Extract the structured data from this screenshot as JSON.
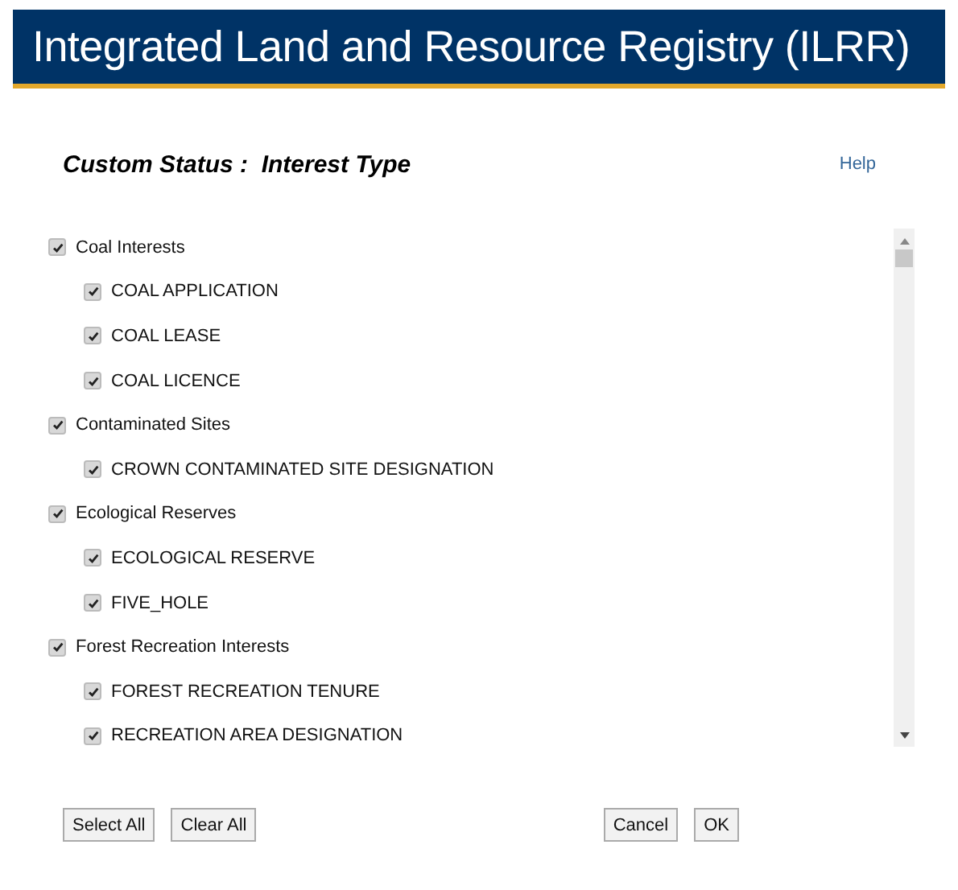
{
  "header": {
    "title": "Integrated Land and Resource Registry (ILRR)"
  },
  "page": {
    "heading": "Custom Status :  Interest Type",
    "help_link": "Help"
  },
  "tree": [
    {
      "label": "Coal Interests",
      "checked": true,
      "children": [
        {
          "label": "COAL APPLICATION",
          "checked": true
        },
        {
          "label": "COAL LEASE",
          "checked": true
        },
        {
          "label": "COAL LICENCE",
          "checked": true
        }
      ]
    },
    {
      "label": "Contaminated Sites",
      "checked": true,
      "children": [
        {
          "label": "CROWN CONTAMINATED SITE DESIGNATION",
          "checked": true
        }
      ]
    },
    {
      "label": "Ecological Reserves",
      "checked": true,
      "children": [
        {
          "label": "ECOLOGICAL RESERVE",
          "checked": true
        },
        {
          "label": "FIVE_HOLE",
          "checked": true
        }
      ]
    },
    {
      "label": "Forest Recreation Interests",
      "checked": true,
      "children": [
        {
          "label": "FOREST RECREATION TENURE",
          "checked": true
        },
        {
          "label": "RECREATION AREA DESIGNATION",
          "checked": true
        }
      ]
    }
  ],
  "left_buttons": [
    "Select All",
    "Clear All"
  ],
  "right_buttons": [
    "Cancel",
    "OK"
  ]
}
